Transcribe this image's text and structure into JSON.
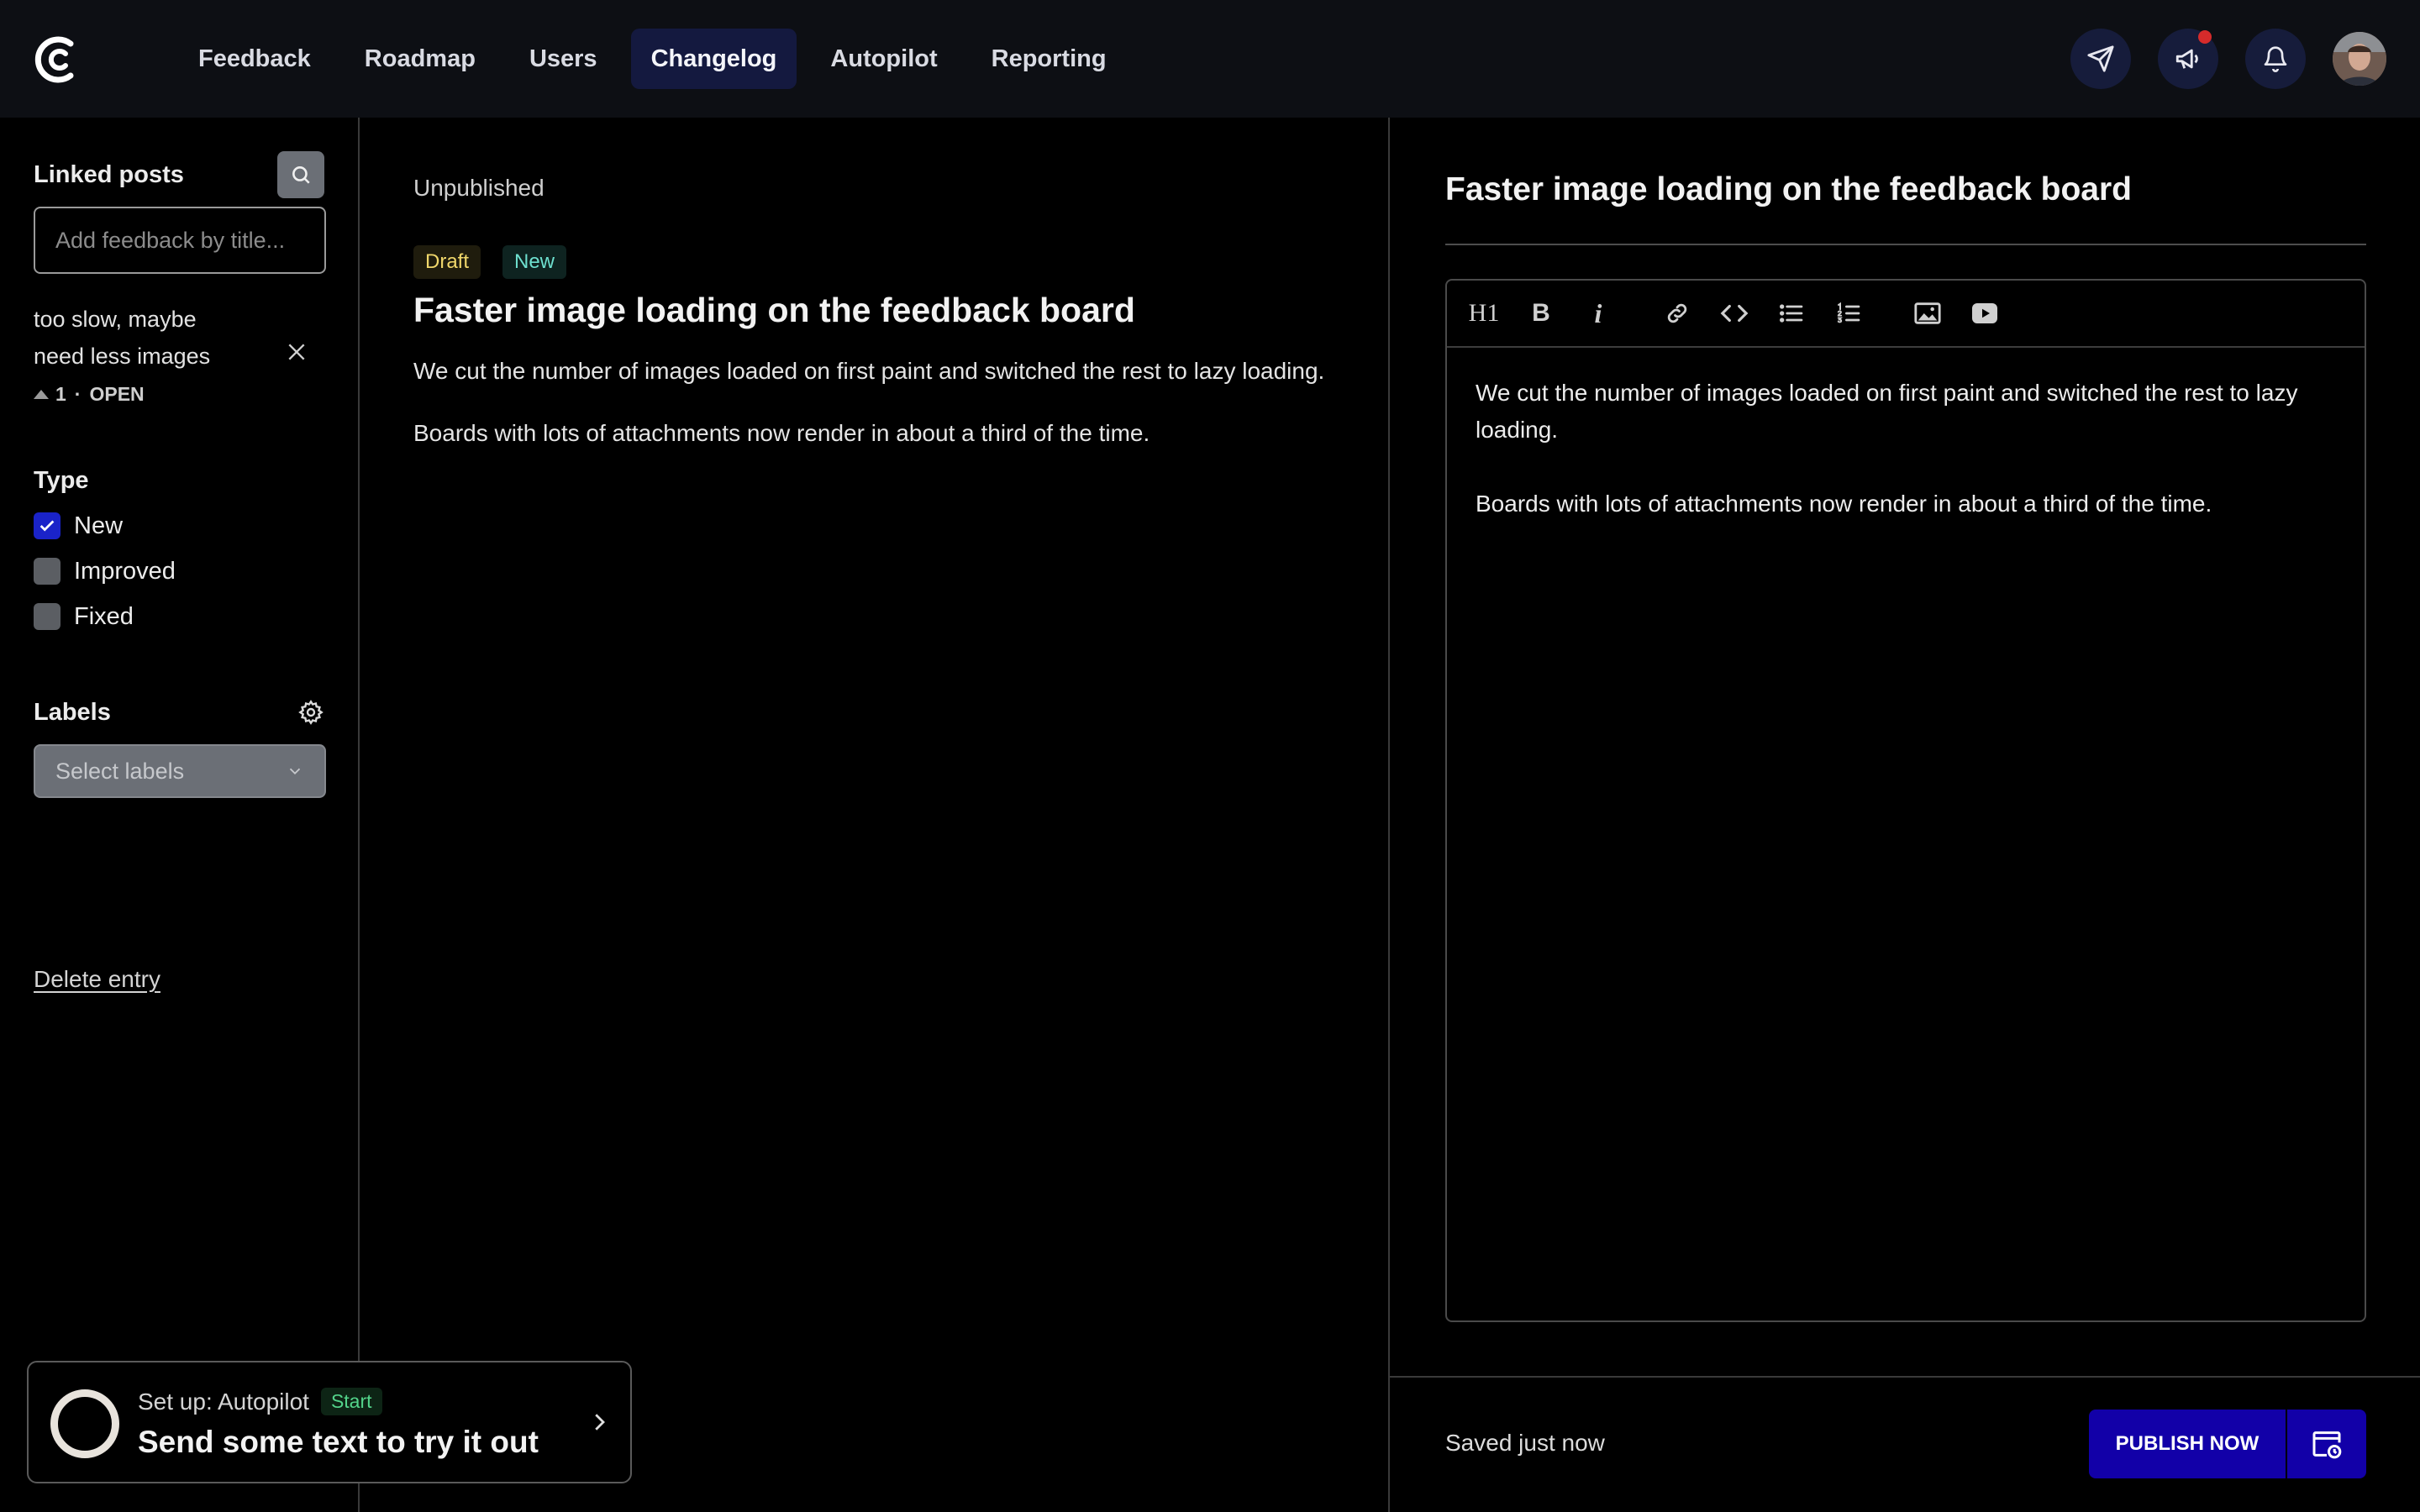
{
  "nav": {
    "items": [
      {
        "label": "Feedback",
        "active": false
      },
      {
        "label": "Roadmap",
        "active": false
      },
      {
        "label": "Users",
        "active": false
      },
      {
        "label": "Changelog",
        "active": true
      },
      {
        "label": "Autopilot",
        "active": false
      },
      {
        "label": "Reporting",
        "active": false
      }
    ],
    "right_icons": [
      "send-icon",
      "megaphone-icon",
      "bell-icon"
    ],
    "notification_dot_color": "#d62b2b"
  },
  "sidebar": {
    "linked_posts_label": "Linked posts",
    "search_placeholder": "Add feedback by title...",
    "linked_post": {
      "title": "too slow, maybe need less images",
      "votes": "1",
      "separator": "·",
      "status": "OPEN"
    },
    "type_label": "Type",
    "types": [
      {
        "label": "New",
        "checked": true
      },
      {
        "label": "Improved",
        "checked": false
      },
      {
        "label": "Fixed",
        "checked": false
      }
    ],
    "labels_label": "Labels",
    "labels_select_placeholder": "Select labels",
    "delete_label": "Delete entry"
  },
  "preview": {
    "status": "Unpublished",
    "badges": {
      "draft": "Draft",
      "new": "New"
    },
    "title": "Faster image loading on the feedback board",
    "paragraphs": [
      "We cut the number of images loaded on first paint and switched the rest to lazy loading.",
      "Boards with lots of attachments now render in about a third of the time."
    ]
  },
  "editor": {
    "title": "Faster image loading on the feedback board",
    "toolbar": [
      "heading-icon",
      "bold-icon",
      "italic-icon",
      "link-icon",
      "code-icon",
      "bullet-list-icon",
      "numbered-list-icon",
      "image-icon",
      "video-icon"
    ],
    "heading_glyph": "H1",
    "bold_glyph": "B",
    "italic_glyph": "i",
    "paragraphs": [
      "We cut the number of images loaded on first paint and switched the rest to lazy loading.",
      "Boards with lots of attachments now render in about a third of the time."
    ],
    "saved_status": "Saved just now",
    "publish_label": "PUBLISH NOW"
  },
  "setup_card": {
    "prefix": "Set up: Autopilot",
    "badge": "Start",
    "headline": "Send some text to try it out"
  },
  "colors": {
    "accent": "#1200a8",
    "nav_active_bg": "#14193f",
    "checkbox_checked": "#1a23c9",
    "draft_badge_text": "#f0d76b",
    "new_badge_text": "#6ee0cf",
    "start_badge_text": "#53d38a"
  }
}
